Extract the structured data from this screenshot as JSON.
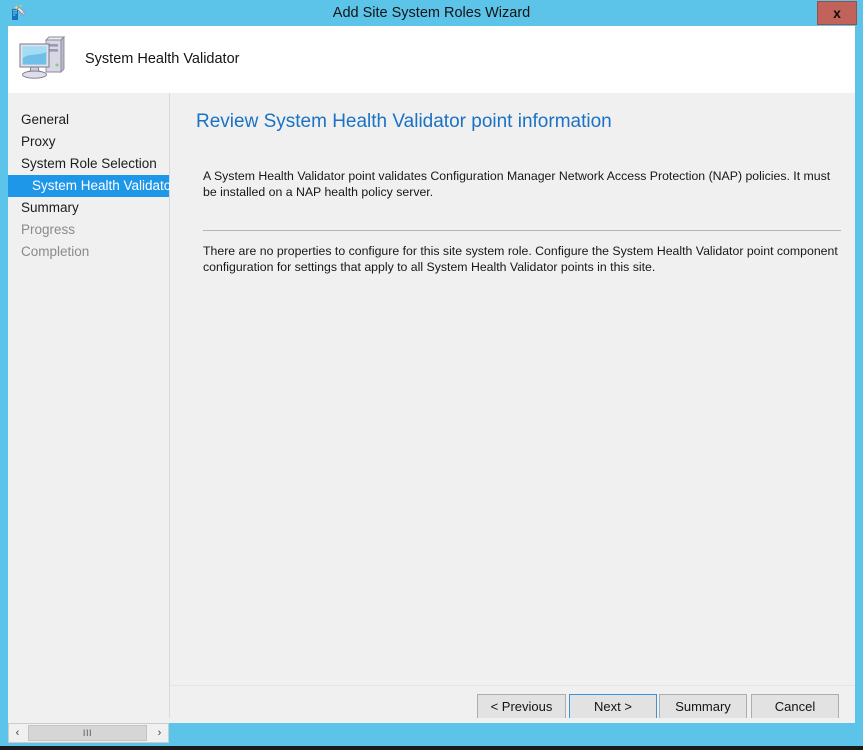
{
  "window": {
    "title": "Add Site System Roles Wizard",
    "close_label": "x",
    "title_icon": "wizard-wand-icon",
    "border_color": "#5bc4e8"
  },
  "header": {
    "title": "System Health Validator",
    "icon": "computer-monitor-icon"
  },
  "sidebar": {
    "items": [
      {
        "label": "General",
        "state": "normal",
        "indent": false
      },
      {
        "label": "Proxy",
        "state": "normal",
        "indent": false
      },
      {
        "label": "System Role Selection",
        "state": "normal",
        "indent": false
      },
      {
        "label": "System Health Validator",
        "state": "selected",
        "indent": true
      },
      {
        "label": "Summary",
        "state": "normal",
        "indent": false
      },
      {
        "label": "Progress",
        "state": "disabled",
        "indent": false
      },
      {
        "label": "Completion",
        "state": "disabled",
        "indent": false
      }
    ],
    "selected_color": "#1f97e8"
  },
  "content": {
    "heading": "Review System Health Validator point information",
    "heading_color": "#1a72c4",
    "paragraph_one": "A System Health Validator point validates Configuration Manager Network Access Protection (NAP) policies. It must be installed on a NAP health policy server.",
    "paragraph_two": "There are no properties to configure for this site system role.  Configure the System Health Validator point component configuration for settings that apply to all System Health Validator points in this site."
  },
  "buttons": {
    "previous": "< Previous",
    "next": "Next >",
    "summary": "Summary",
    "cancel": "Cancel",
    "focused": "next"
  },
  "scrollbar": {
    "left_arrow": "‹",
    "right_arrow": "›",
    "thumb_grip": "III"
  }
}
